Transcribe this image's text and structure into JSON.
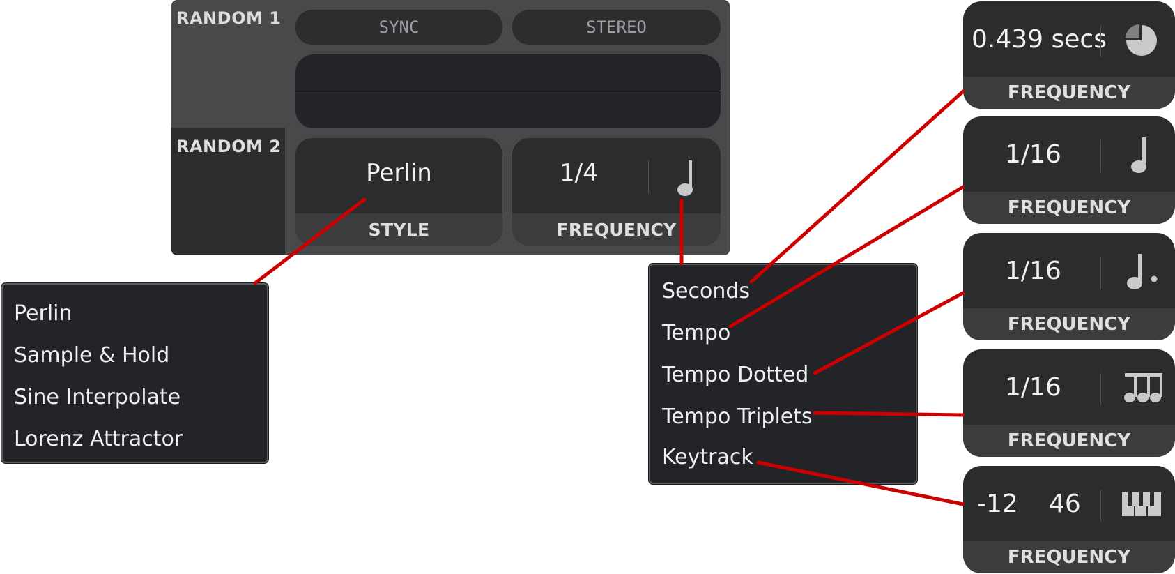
{
  "module": {
    "tabs": [
      "RANDOM 1",
      "RANDOM 2"
    ],
    "sync_label": "SYNC",
    "stereo_label": "STEREO",
    "style_value": "Perlin",
    "style_label": "STYLE",
    "frequency_value": "1/4",
    "frequency_label": "FREQUENCY"
  },
  "style_menu": {
    "items": [
      "Perlin",
      "Sample & Hold",
      "Sine Interpolate",
      "Lorenz Attractor"
    ]
  },
  "freq_menu": {
    "items": [
      "Seconds",
      "Tempo",
      "Tempo Dotted",
      "Tempo Triplets",
      "Keytrack"
    ]
  },
  "freq_cards": [
    {
      "value": "0.439 secs",
      "label": "FREQUENCY",
      "icon": "pie-clock-icon"
    },
    {
      "value": "1/16",
      "label": "FREQUENCY",
      "icon": "quarter-note-icon"
    },
    {
      "value": "1/16",
      "label": "FREQUENCY",
      "icon": "dotted-note-icon"
    },
    {
      "value": "1/16",
      "label": "FREQUENCY",
      "icon": "triplet-notes-icon"
    },
    {
      "value_a": "-12",
      "value_b": "46",
      "label": "FREQUENCY",
      "icon": "piano-keys-icon"
    }
  ],
  "colors": {
    "callout": "#cc0000",
    "panel_bg": "#48494b",
    "control_bg": "#2b2c2e",
    "menu_bg": "#222428"
  }
}
